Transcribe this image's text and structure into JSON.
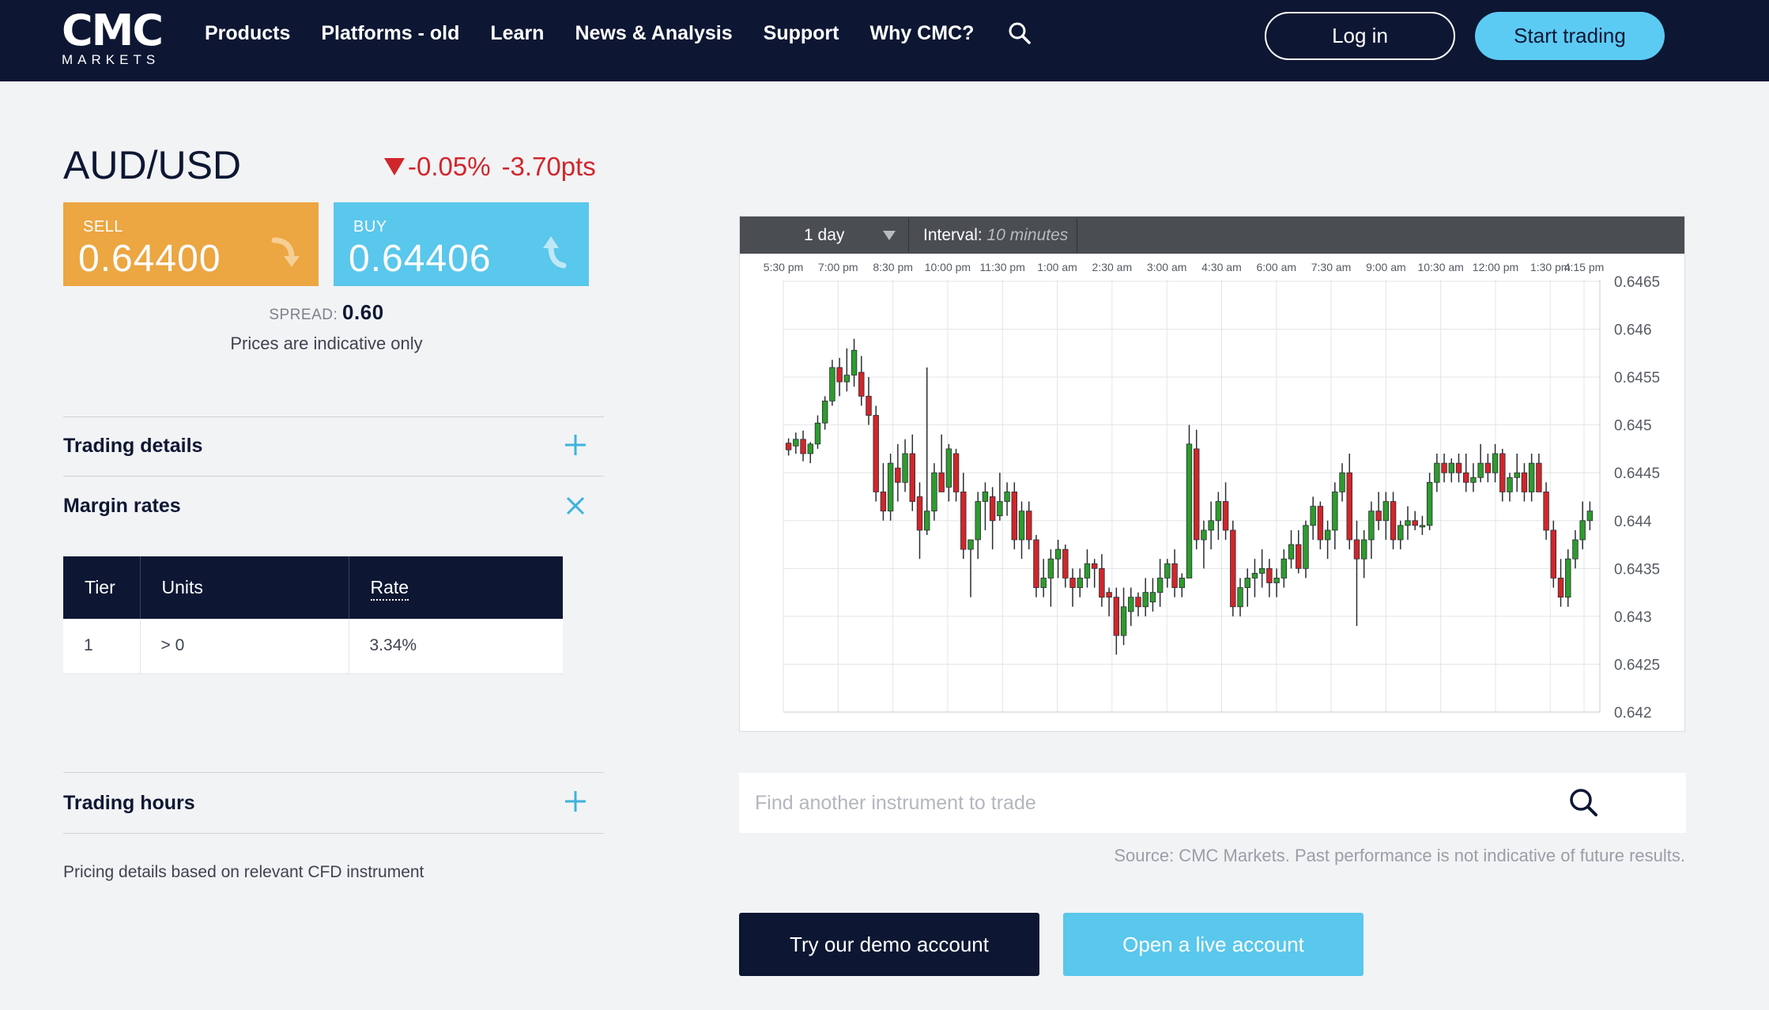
{
  "header": {
    "logo_mark": "CMC",
    "logo_sub": "MARKETS",
    "nav": [
      "Products",
      "Platforms - old",
      "Learn",
      "News & Analysis",
      "Support",
      "Why CMC?"
    ],
    "login_label": "Log in",
    "start_label": "Start trading"
  },
  "instrument": {
    "pair": "AUD/USD",
    "change_pct": "-0.05%",
    "change_pts": "-3.70pts",
    "sell_label": "SELL",
    "sell_price": "0.64400",
    "buy_label": "BUY",
    "buy_price": "0.64406",
    "spread_label": "SPREAD:",
    "spread_value": "0.60",
    "indicative": "Prices are indicative only"
  },
  "accordion": {
    "trading_details": "Trading details",
    "margin_rates": "Margin rates",
    "trading_hours": "Trading hours"
  },
  "margin_table": {
    "headers": [
      "Tier",
      "Units",
      "Rate"
    ],
    "rows": [
      [
        "1",
        "> 0",
        "3.34%"
      ]
    ]
  },
  "pricing_note": "Pricing details based on relevant CFD instrument",
  "chart_toolbar": {
    "timeframe": "1 day",
    "interval_label": "Interval:",
    "interval_value": "10 minutes"
  },
  "search": {
    "placeholder": "Find another instrument to trade"
  },
  "source_note": "Source: CMC Markets. Past performance is not indicative of future results.",
  "cta": {
    "demo": "Try our demo account",
    "live": "Open a live account"
  },
  "colors": {
    "navy": "#0d1733",
    "sell": "#eca642",
    "buy": "#5ac7ec",
    "up": "#2e9b2e",
    "down": "#d0262b"
  },
  "chart_data": {
    "type": "candlestick",
    "x_ticks": [
      "5:30 pm",
      "7:00 pm",
      "8:30 pm",
      "10:00 pm",
      "11:30 pm",
      "1:00 am",
      "2:30 am",
      "3:00 am",
      "4:30 am",
      "6:00 am",
      "7:30 am",
      "9:00 am",
      "10:30 am",
      "12:00 pm",
      "1:30 pm",
      "4:15 pm"
    ],
    "y_ticks": [
      "0.6465",
      "0.646",
      "0.6455",
      "0.645",
      "0.6445",
      "0.644",
      "0.6435",
      "0.643",
      "0.6425",
      "0.642"
    ],
    "ylim": [
      0.642,
      0.6465
    ],
    "grid": true,
    "candles": [
      [
        0.64481,
        0.64486,
        0.64468,
        0.64474
      ],
      [
        0.64478,
        0.64492,
        0.6447,
        0.64485
      ],
      [
        0.64485,
        0.64494,
        0.64462,
        0.6447
      ],
      [
        0.6447,
        0.64482,
        0.6446,
        0.6448
      ],
      [
        0.6448,
        0.6451,
        0.64475,
        0.64502
      ],
      [
        0.64502,
        0.6453,
        0.64495,
        0.64525
      ],
      [
        0.64525,
        0.64568,
        0.6452,
        0.6456
      ],
      [
        0.6456,
        0.6457,
        0.6453,
        0.64545
      ],
      [
        0.64545,
        0.6458,
        0.64535,
        0.64552
      ],
      [
        0.64552,
        0.6459,
        0.6454,
        0.64578
      ],
      [
        0.64555,
        0.64572,
        0.6452,
        0.6453
      ],
      [
        0.6453,
        0.6455,
        0.645,
        0.6451
      ],
      [
        0.6451,
        0.6452,
        0.6442,
        0.6443
      ],
      [
        0.6443,
        0.6446,
        0.644,
        0.6441
      ],
      [
        0.6441,
        0.6447,
        0.644,
        0.6446
      ],
      [
        0.64455,
        0.6448,
        0.6442,
        0.6444
      ],
      [
        0.6444,
        0.64485,
        0.6443,
        0.6447
      ],
      [
        0.6447,
        0.6449,
        0.6441,
        0.6442
      ],
      [
        0.64425,
        0.6444,
        0.6436,
        0.6439
      ],
      [
        0.6439,
        0.6456,
        0.64385,
        0.6441
      ],
      [
        0.6441,
        0.6446,
        0.644,
        0.6445
      ],
      [
        0.6445,
        0.6449,
        0.6443,
        0.6443
      ],
      [
        0.64435,
        0.6448,
        0.6442,
        0.64475
      ],
      [
        0.6447,
        0.64475,
        0.6442,
        0.6443
      ],
      [
        0.6443,
        0.6445,
        0.6436,
        0.6437
      ],
      [
        0.6437,
        0.6438,
        0.6432,
        0.6438
      ],
      [
        0.6438,
        0.6443,
        0.6436,
        0.6442
      ],
      [
        0.6442,
        0.6444,
        0.6439,
        0.6443
      ],
      [
        0.64425,
        0.64435,
        0.6437,
        0.644
      ],
      [
        0.64405,
        0.6445,
        0.644,
        0.6442
      ],
      [
        0.6442,
        0.6444,
        0.64405,
        0.6443
      ],
      [
        0.6443,
        0.6444,
        0.6437,
        0.6438
      ],
      [
        0.6438,
        0.6442,
        0.6436,
        0.6441
      ],
      [
        0.6441,
        0.6442,
        0.6437,
        0.6438
      ],
      [
        0.6438,
        0.64385,
        0.6432,
        0.6433
      ],
      [
        0.6433,
        0.6436,
        0.6432,
        0.6434
      ],
      [
        0.6434,
        0.6437,
        0.6431,
        0.6436
      ],
      [
        0.6436,
        0.6438,
        0.6434,
        0.6437
      ],
      [
        0.6437,
        0.64375,
        0.6433,
        0.6434
      ],
      [
        0.6434,
        0.6435,
        0.6431,
        0.6433
      ],
      [
        0.6433,
        0.6435,
        0.6432,
        0.6434
      ],
      [
        0.6434,
        0.6437,
        0.6433,
        0.64355
      ],
      [
        0.64355,
        0.6436,
        0.6433,
        0.6435
      ],
      [
        0.6435,
        0.64365,
        0.6431,
        0.6432
      ],
      [
        0.64325,
        0.6433,
        0.643,
        0.6432
      ],
      [
        0.6432,
        0.6433,
        0.6426,
        0.6428
      ],
      [
        0.6428,
        0.6433,
        0.6427,
        0.6431
      ],
      [
        0.64305,
        0.6433,
        0.6429,
        0.6432
      ],
      [
        0.6432,
        0.64325,
        0.643,
        0.6431
      ],
      [
        0.6431,
        0.6434,
        0.643,
        0.64325
      ],
      [
        0.64315,
        0.6434,
        0.64305,
        0.64325
      ],
      [
        0.64325,
        0.6436,
        0.6431,
        0.6434
      ],
      [
        0.6434,
        0.6436,
        0.6433,
        0.64355
      ],
      [
        0.64355,
        0.6437,
        0.6432,
        0.6433
      ],
      [
        0.6433,
        0.64345,
        0.6432,
        0.6434
      ],
      [
        0.6434,
        0.645,
        0.6434,
        0.6448
      ],
      [
        0.64475,
        0.64495,
        0.6437,
        0.6438
      ],
      [
        0.6438,
        0.644,
        0.6435,
        0.6439
      ],
      [
        0.6439,
        0.6442,
        0.6437,
        0.644
      ],
      [
        0.644,
        0.6443,
        0.6438,
        0.6442
      ],
      [
        0.6442,
        0.6444,
        0.6438,
        0.6439
      ],
      [
        0.6439,
        0.644,
        0.643,
        0.6431
      ],
      [
        0.6431,
        0.6434,
        0.643,
        0.6433
      ],
      [
        0.6433,
        0.6435,
        0.6431,
        0.6434
      ],
      [
        0.6434,
        0.6436,
        0.6432,
        0.64345
      ],
      [
        0.64345,
        0.6437,
        0.6433,
        0.6435
      ],
      [
        0.6435,
        0.6436,
        0.6432,
        0.64335
      ],
      [
        0.64335,
        0.6435,
        0.6432,
        0.6434
      ],
      [
        0.6434,
        0.6437,
        0.6433,
        0.6436
      ],
      [
        0.6436,
        0.6439,
        0.6435,
        0.64375
      ],
      [
        0.64375,
        0.6439,
        0.64345,
        0.6435
      ],
      [
        0.6435,
        0.644,
        0.6434,
        0.64395
      ],
      [
        0.64395,
        0.64425,
        0.6438,
        0.64415
      ],
      [
        0.64415,
        0.6442,
        0.6437,
        0.6438
      ],
      [
        0.6438,
        0.644,
        0.6436,
        0.6439
      ],
      [
        0.6439,
        0.6444,
        0.6437,
        0.6443
      ],
      [
        0.6443,
        0.6446,
        0.6442,
        0.6445
      ],
      [
        0.6445,
        0.6447,
        0.6437,
        0.6438
      ],
      [
        0.6438,
        0.644,
        0.6429,
        0.6436
      ],
      [
        0.6436,
        0.6439,
        0.6434,
        0.6438
      ],
      [
        0.6438,
        0.6442,
        0.6436,
        0.6441
      ],
      [
        0.6441,
        0.6443,
        0.6439,
        0.644
      ],
      [
        0.644,
        0.6443,
        0.6438,
        0.6442
      ],
      [
        0.6442,
        0.6443,
        0.6437,
        0.6438
      ],
      [
        0.6438,
        0.644,
        0.6437,
        0.64395
      ],
      [
        0.64395,
        0.64415,
        0.6438,
        0.644
      ],
      [
        0.644,
        0.6441,
        0.6439,
        0.64395
      ],
      [
        0.64395,
        0.64405,
        0.64385,
        0.64395
      ],
      [
        0.64395,
        0.6445,
        0.6439,
        0.6444
      ],
      [
        0.6444,
        0.6447,
        0.6443,
        0.6446
      ],
      [
        0.6446,
        0.6447,
        0.6444,
        0.6445
      ],
      [
        0.6445,
        0.64465,
        0.6444,
        0.6446
      ],
      [
        0.6446,
        0.6447,
        0.6444,
        0.6445
      ],
      [
        0.6445,
        0.6447,
        0.6443,
        0.6444
      ],
      [
        0.6444,
        0.6446,
        0.6443,
        0.64445
      ],
      [
        0.64445,
        0.6448,
        0.6444,
        0.6446
      ],
      [
        0.6446,
        0.6447,
        0.6444,
        0.6445
      ],
      [
        0.6445,
        0.6448,
        0.6444,
        0.6447
      ],
      [
        0.6447,
        0.64475,
        0.6442,
        0.6443
      ],
      [
        0.6443,
        0.6445,
        0.6442,
        0.64445
      ],
      [
        0.64445,
        0.6447,
        0.6443,
        0.6445
      ],
      [
        0.6445,
        0.6446,
        0.6442,
        0.6443
      ],
      [
        0.6443,
        0.6447,
        0.6442,
        0.6446
      ],
      [
        0.6446,
        0.6447,
        0.6443,
        0.6443
      ],
      [
        0.6443,
        0.6444,
        0.6438,
        0.6439
      ],
      [
        0.6439,
        0.644,
        0.6433,
        0.6434
      ],
      [
        0.6434,
        0.6436,
        0.6431,
        0.6432
      ],
      [
        0.6432,
        0.6437,
        0.6431,
        0.6436
      ],
      [
        0.6436,
        0.6439,
        0.6435,
        0.6438
      ],
      [
        0.6438,
        0.6442,
        0.6437,
        0.644
      ],
      [
        0.644,
        0.6442,
        0.6439,
        0.6441
      ]
    ]
  }
}
